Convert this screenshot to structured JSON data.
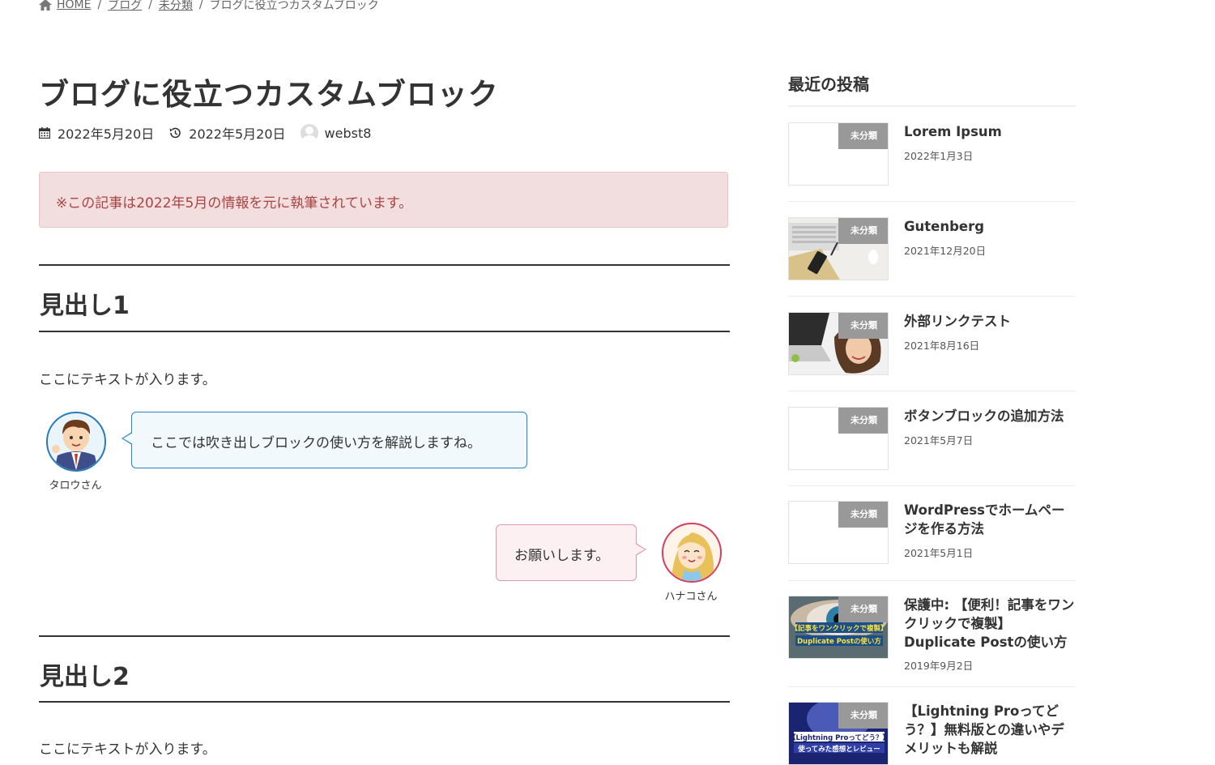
{
  "breadcrumb": {
    "home": "HOME",
    "blog": "ブログ",
    "category": "未分類",
    "current": "ブログに役立つカスタムブロック",
    "separator": "/"
  },
  "post": {
    "title": "ブログに役立つカスタムブロック",
    "published": "2022年5月20日",
    "updated": "2022年5月20日",
    "author": "webst8",
    "notice": "※この記事は2022年5月の情報を元に執筆されています。",
    "heading1": "見出し1",
    "text1": "ここにテキストが入ります。",
    "balloon_left": {
      "name": "タロウさん",
      "text": "ここでは吹き出しブロックの使い方を解説しますね。"
    },
    "balloon_right": {
      "name": "ハナコさん",
      "text": "お願いします。"
    },
    "heading2": "見出し2",
    "text2": "ここにテキストが入ります。"
  },
  "sidebar": {
    "title": "最近の投稿",
    "posts": [
      {
        "category": "未分類",
        "title": "Lorem Ipsum",
        "date": "2022年1月3日"
      },
      {
        "category": "未分類",
        "title": "Gutenberg",
        "date": "2021年12月20日"
      },
      {
        "category": "未分類",
        "title": "外部リンクテスト",
        "date": "2021年8月16日"
      },
      {
        "category": "未分類",
        "title": "ボタンブロックの追加方法",
        "date": "2021年5月7日"
      },
      {
        "category": "未分類",
        "title": "WordPressでホームページを作る方法",
        "date": "2021年5月1日"
      },
      {
        "category": "未分類",
        "title": "保護中: 【便利！記事をワンクリックで複製】Duplicate Postの使い方",
        "date": "2019年9月2日",
        "thumb_text_1": "【記事をワンクリックで複製】",
        "thumb_text_2": "Duplicate Postの使い方"
      },
      {
        "category": "未分類",
        "title": "【Lightning Proってどう？】無料版との違いやデメリットも解説",
        "thumb_text_1": "【Lightning Proってどう？】",
        "thumb_text_2": "使ってみた感想とレビュー"
      }
    ]
  }
}
